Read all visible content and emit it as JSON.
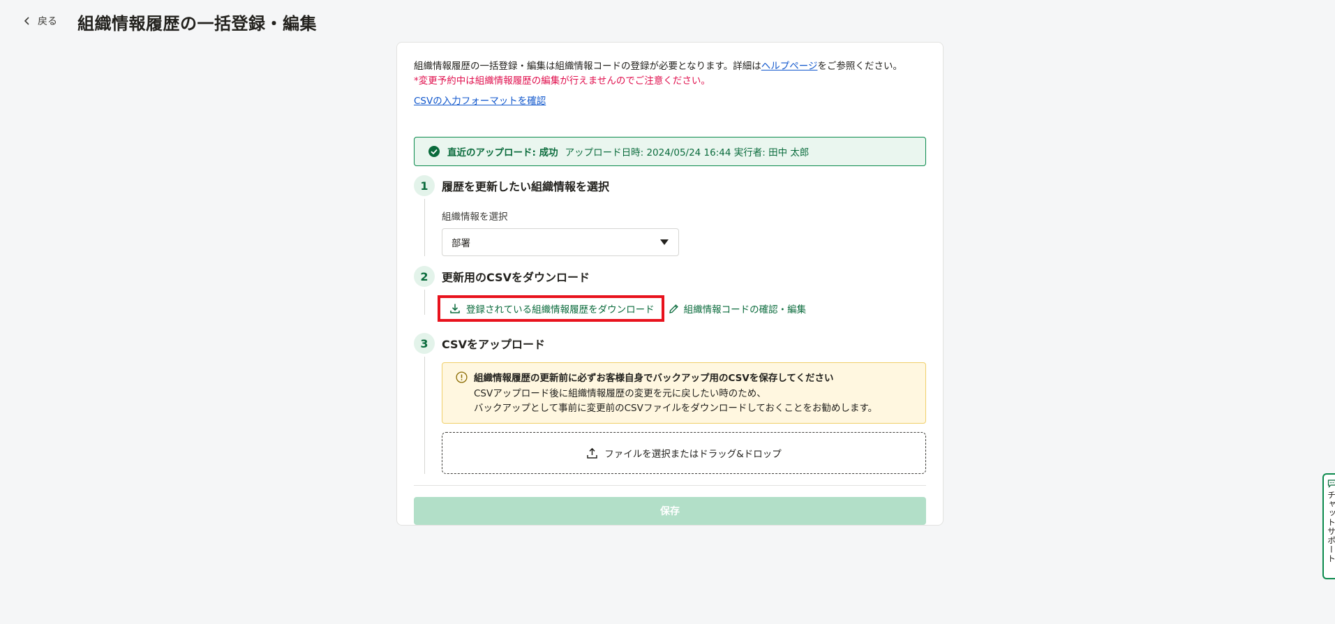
{
  "header": {
    "back_label": "戻る",
    "title": "組織情報履歴の一括登録・編集"
  },
  "intro": {
    "text_before": "組織情報履歴の一括登録・編集は組織情報コードの登録が必要となります。詳細は",
    "help_link": "ヘルプページ",
    "text_after": "をご参照ください。",
    "warning": "*変更予約中は組織情報履歴の編集が行えませんのでご注意ください。",
    "format_link": "CSVの入力フォーマットを確認"
  },
  "banner": {
    "status": "直近のアップロード: 成功",
    "meta": "アップロード日時: 2024/05/24 16:44  実行者: 田中 太郎"
  },
  "steps": [
    {
      "num": "1",
      "title": "履歴を更新したい組織情報を選択"
    },
    {
      "num": "2",
      "title": "更新用のCSVをダウンロード"
    },
    {
      "num": "3",
      "title": "CSVをアップロード"
    }
  ],
  "step1": {
    "select_label": "組織情報を選択",
    "selected_value": "部署"
  },
  "step2": {
    "download_label": "登録されている組織情報履歴をダウンロード",
    "edit_label": "組織情報コードの確認・編集"
  },
  "step3": {
    "notice_title": "組織情報履歴の更新前に必ずお客様自身でバックアップ用のCSVを保存してください",
    "notice_line1": "CSVアップロード後に組織情報履歴の変更を元に戻したい時のため、",
    "notice_line2": "バックアップとして事前に変更前のCSVファイルをダウンロードしておくことをお勧めします。",
    "dropzone_label": "ファイルを選択またはドラッグ&ドロップ"
  },
  "save_label": "保存",
  "chat_tab_label": "チャットサポート",
  "colors": {
    "brand_green": "#0a6b3c",
    "link_blue": "#0f56cc",
    "warning_red": "#e00f4d",
    "highlight_red": "#e8121d",
    "save_disabled": "#b2dfc8"
  }
}
